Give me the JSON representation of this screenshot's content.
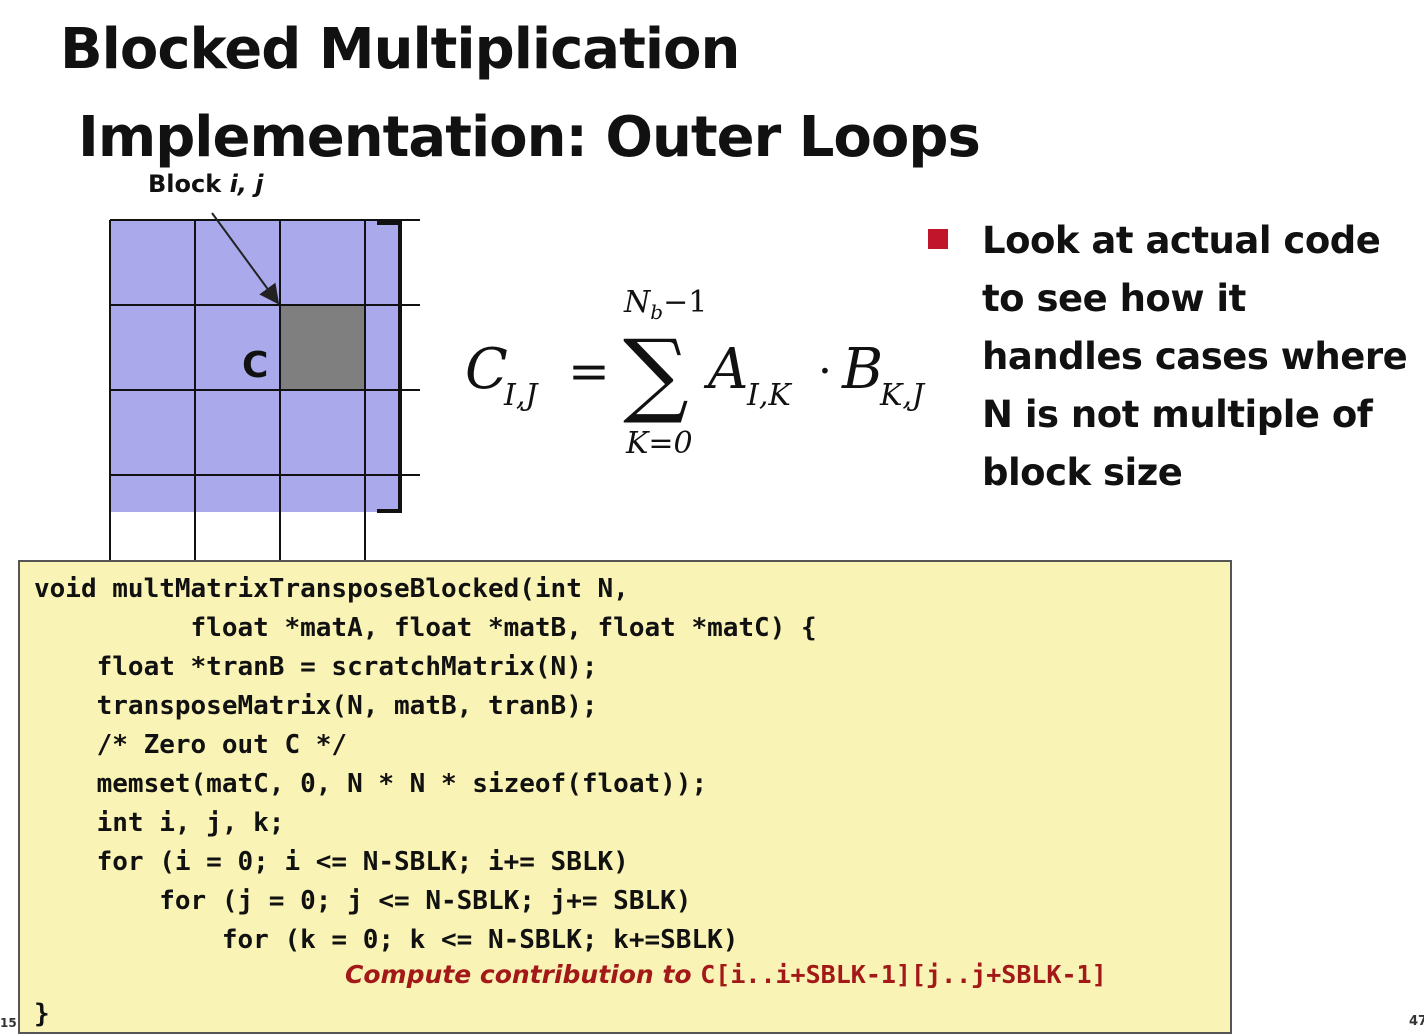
{
  "slide": {
    "title_line1": "Blocked Multiplication",
    "title_line2": "Implementation: Outer Loops"
  },
  "diagram": {
    "block_label_prefix": "Block ",
    "block_label_vars": "i, j",
    "c_label": "C",
    "colors": {
      "block_fill": "#a9a9ec",
      "highlight_fill": "#7f7f7f",
      "bullet": "#c0152a"
    }
  },
  "formula": {
    "lhs": "C",
    "lhs_sub": "I,J",
    "equals": "=",
    "sum_symbol": "∑",
    "upper": "N",
    "upper_sub": "b",
    "upper_rest": "−1",
    "lower": "K=0",
    "a": "A",
    "a_sub": "I,K",
    "dot": "·",
    "b": "B",
    "b_sub": "K,J"
  },
  "bullet": {
    "text": "Look at actual code to see how it handles cases where N is not multiple of block size"
  },
  "code": {
    "lines": [
      "void multMatrixTransposeBlocked(int N,",
      "          float *matA, float *matB, float *matC) {",
      "    float *tranB = scratchMatrix(N);",
      "    transposeMatrix(N, matB, tranB);",
      "    /* Zero out C */",
      "    memset(matC, 0, N * N * sizeof(float));",
      "    int i, j, k;",
      "    for (i = 0; i <= N-SBLK; i+= SBLK)",
      "        for (j = 0; j <= N-SBLK; j+= SBLK)",
      "            for (k = 0; k <= N-SBLK; k+=SBLK)"
    ],
    "comment_text": "Compute contribution to ",
    "comment_code": "C[i..i+SBLK-1][j..j+SBLK-1]",
    "closing": "}"
  },
  "footer": {
    "page_left": "15",
    "page_right": "47"
  }
}
